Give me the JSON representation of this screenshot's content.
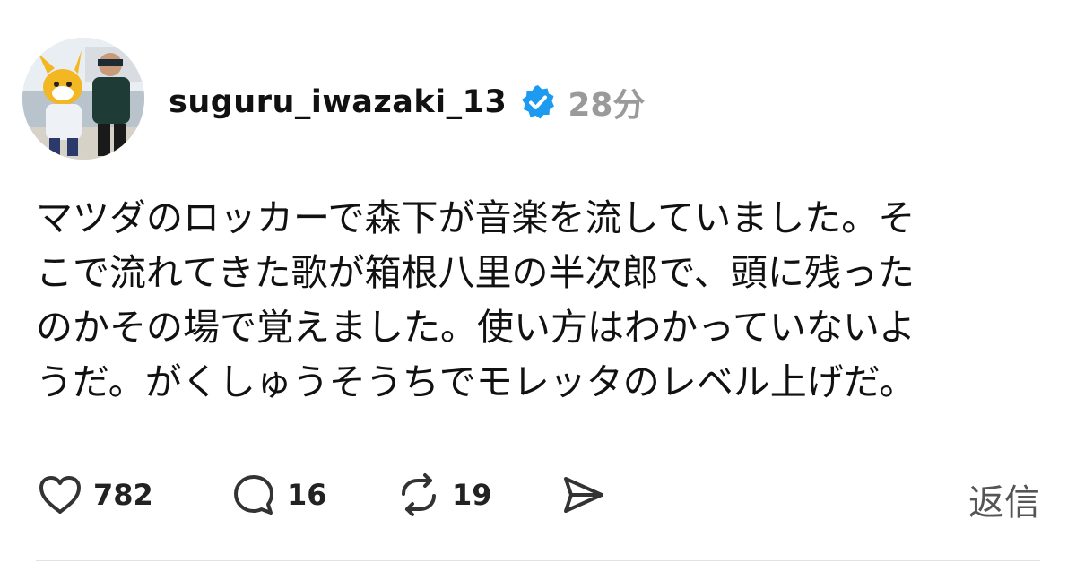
{
  "post": {
    "username": "suguru_iwazaki_13",
    "timestamp": "28分",
    "body_lines": [
      "マツダのロッカーで森下が音楽を流していました。そ",
      "こで流れてきた歌が箱根八里の半次郎で、頭に残った",
      "のかその場で覚えました。使い方はわかっていないよ",
      "うだ。がくしゅうそうちでモレッタのレベル上げだ。"
    ],
    "verified_icon": "verified-badge-icon",
    "verified_color": "#1d9bf0"
  },
  "actions": {
    "like": {
      "icon": "heart-icon",
      "count": "782"
    },
    "reply": {
      "icon": "speech-bubble-icon",
      "count": "16"
    },
    "repost": {
      "icon": "repost-arrows-icon",
      "count": "19"
    },
    "share": {
      "icon": "send-icon"
    },
    "reply_label": "返信"
  }
}
